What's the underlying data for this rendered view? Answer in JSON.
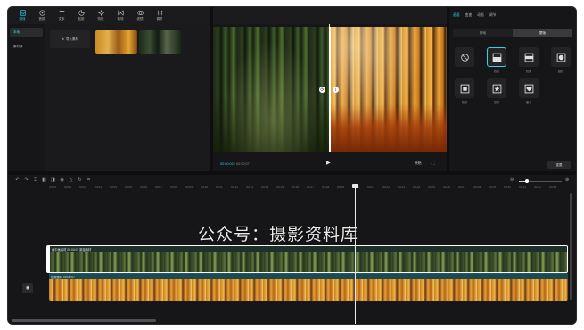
{
  "toolbar": {
    "items": [
      {
        "label": "媒体",
        "icon": "media-icon",
        "active": true
      },
      {
        "label": "音频",
        "icon": "audio-icon"
      },
      {
        "label": "文本",
        "icon": "text-icon"
      },
      {
        "label": "贴纸",
        "icon": "sticker-icon"
      },
      {
        "label": "特效",
        "icon": "effects-icon"
      },
      {
        "label": "转场",
        "icon": "transition-icon"
      },
      {
        "label": "滤镜",
        "icon": "filter-icon"
      },
      {
        "label": "调节",
        "icon": "adjust-icon"
      }
    ]
  },
  "media": {
    "sidebar": [
      "本地",
      "素材库"
    ],
    "import_label": "导入素材"
  },
  "player": {
    "timecode_current": "00:00:02",
    "timecode_total": "00:00:07",
    "ratio_label": "原始"
  },
  "props": {
    "tabs": [
      "画面",
      "变速",
      "动画",
      "调节"
    ],
    "active_tab": 0,
    "segments": [
      "基础",
      "蒙版"
    ],
    "active_segment": 1,
    "masks": [
      {
        "label": "",
        "icon": "none-icon"
      },
      {
        "label": "线性",
        "icon": "linear-mask-icon",
        "selected": true
      },
      {
        "label": "镜面",
        "icon": "mirror-mask-icon"
      },
      {
        "label": "圆形",
        "icon": "circle-mask-icon"
      },
      {
        "label": "矩形",
        "icon": "rectangle-mask-icon"
      },
      {
        "label": "星形",
        "icon": "star-mask-icon"
      },
      {
        "label": "爱心",
        "icon": "heart-mask-icon"
      }
    ],
    "reset_label": "重置"
  },
  "timeline": {
    "ruler_labels": [
      "00:00",
      "00:01",
      "00:02",
      "00:03",
      "00:04",
      "00:05",
      "00:06",
      "00:07",
      "00:08",
      "00:09",
      "00:10",
      "00:11",
      "00:12",
      "00:13",
      "00:14",
      "00:15",
      "00:16",
      "00:17",
      "00:18",
      "00:19",
      "00:20",
      "00:21",
      "00:22",
      "00:23",
      "00:24",
      "00:25",
      "00:26",
      "00:27",
      "00:28",
      "00:29",
      "00:30",
      "00:31",
      "00:32",
      "00:33"
    ],
    "track1_label": "画中画素材  00:00:07  原始素材",
    "track2_label": "视频素材  00:00:07",
    "watermark": "公众号：摄影资料库",
    "zoom_level": 0.18
  },
  "colors": {
    "accent": "#2ed3e6",
    "window_bg": "#0e0e10",
    "panel_bg": "#161618"
  }
}
